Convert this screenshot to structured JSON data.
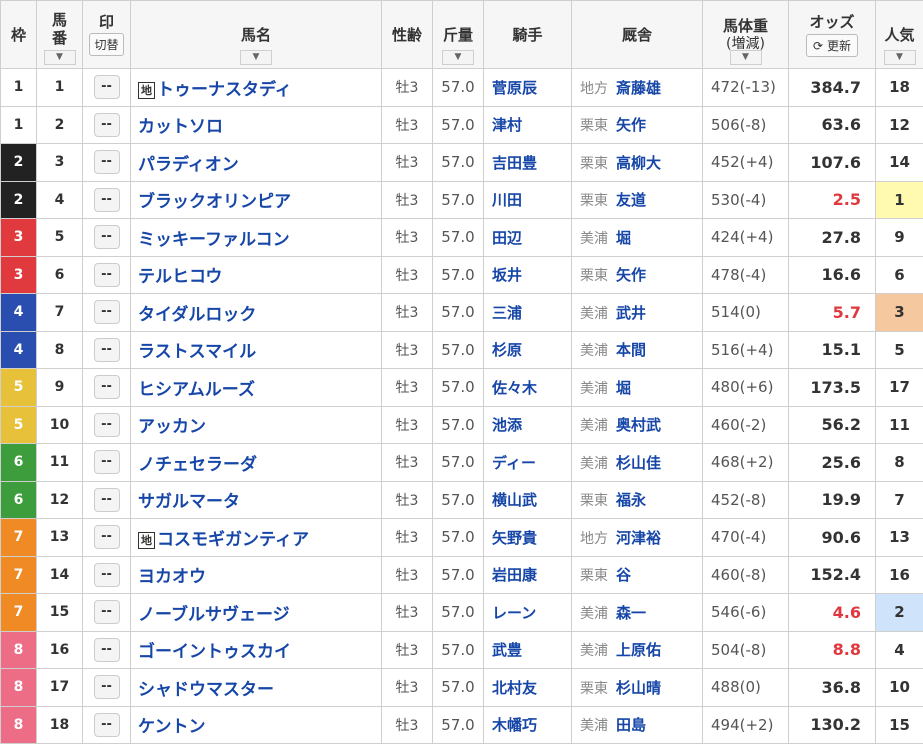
{
  "headers": {
    "waku": "枠",
    "umaban": "馬\n番",
    "mark": "印",
    "mark_toggle": "切替",
    "horse": "馬名",
    "sexage": "性齢",
    "kinryo": "斤量",
    "jockey": "騎手",
    "stable": "厩舎",
    "weight": "馬体重",
    "weight_sub": "(増減)",
    "odds": "オッズ",
    "refresh": "更新",
    "popularity": "人気"
  },
  "mark_placeholder": "--",
  "chiho_badge": "地",
  "waku_colors": {
    "1": "#ffffff",
    "2": "#222222",
    "3": "#e03a3e",
    "4": "#2a4eb0",
    "5": "#e8c13a",
    "6": "#3d9c3c",
    "7": "#ef8a24",
    "8": "#ee6d86"
  },
  "rows": [
    {
      "waku": "1",
      "num": "1",
      "horse": "トゥーナスタディ",
      "chiho": true,
      "sexage": "牡3",
      "kinryo": "57.0",
      "jockey": "菅原辰",
      "region": "地方",
      "trainer": "斎藤雄",
      "weight": "472(-13)",
      "odds": "384.7",
      "pop": "18"
    },
    {
      "waku": "1",
      "num": "2",
      "horse": "カットソロ",
      "chiho": false,
      "sexage": "牡3",
      "kinryo": "57.0",
      "jockey": "津村",
      "region": "栗東",
      "trainer": "矢作",
      "weight": "506(-8)",
      "odds": "63.6",
      "pop": "12"
    },
    {
      "waku": "2",
      "num": "3",
      "horse": "パラディオン",
      "chiho": false,
      "sexage": "牡3",
      "kinryo": "57.0",
      "jockey": "吉田豊",
      "region": "栗東",
      "trainer": "高柳大",
      "weight": "452(+4)",
      "odds": "107.6",
      "pop": "14"
    },
    {
      "waku": "2",
      "num": "4",
      "horse": "ブラックオリンピア",
      "chiho": false,
      "sexage": "牡3",
      "kinryo": "57.0",
      "jockey": "川田",
      "region": "栗東",
      "trainer": "友道",
      "weight": "530(-4)",
      "odds": "2.5",
      "pop": "1"
    },
    {
      "waku": "3",
      "num": "5",
      "horse": "ミッキーファルコン",
      "chiho": false,
      "sexage": "牡3",
      "kinryo": "57.0",
      "jockey": "田辺",
      "region": "美浦",
      "trainer": "堀",
      "weight": "424(+4)",
      "odds": "27.8",
      "pop": "9"
    },
    {
      "waku": "3",
      "num": "6",
      "horse": "テルヒコウ",
      "chiho": false,
      "sexage": "牡3",
      "kinryo": "57.0",
      "jockey": "坂井",
      "region": "栗東",
      "trainer": "矢作",
      "weight": "478(-4)",
      "odds": "16.6",
      "pop": "6"
    },
    {
      "waku": "4",
      "num": "7",
      "horse": "タイダルロック",
      "chiho": false,
      "sexage": "牡3",
      "kinryo": "57.0",
      "jockey": "三浦",
      "region": "美浦",
      "trainer": "武井",
      "weight": "514(0)",
      "odds": "5.7",
      "pop": "3"
    },
    {
      "waku": "4",
      "num": "8",
      "horse": "ラストスマイル",
      "chiho": false,
      "sexage": "牡3",
      "kinryo": "57.0",
      "jockey": "杉原",
      "region": "美浦",
      "trainer": "本間",
      "weight": "516(+4)",
      "odds": "15.1",
      "pop": "5"
    },
    {
      "waku": "5",
      "num": "9",
      "horse": "ヒシアムルーズ",
      "chiho": false,
      "sexage": "牡3",
      "kinryo": "57.0",
      "jockey": "佐々木",
      "region": "美浦",
      "trainer": "堀",
      "weight": "480(+6)",
      "odds": "173.5",
      "pop": "17"
    },
    {
      "waku": "5",
      "num": "10",
      "horse": "アッカン",
      "chiho": false,
      "sexage": "牡3",
      "kinryo": "57.0",
      "jockey": "池添",
      "region": "美浦",
      "trainer": "奥村武",
      "weight": "460(-2)",
      "odds": "56.2",
      "pop": "11"
    },
    {
      "waku": "6",
      "num": "11",
      "horse": "ノチェセラーダ",
      "chiho": false,
      "sexage": "牡3",
      "kinryo": "57.0",
      "jockey": "ディー",
      "region": "美浦",
      "trainer": "杉山佳",
      "weight": "468(+2)",
      "odds": "25.6",
      "pop": "8"
    },
    {
      "waku": "6",
      "num": "12",
      "horse": "サガルマータ",
      "chiho": false,
      "sexage": "牡3",
      "kinryo": "57.0",
      "jockey": "横山武",
      "region": "栗東",
      "trainer": "福永",
      "weight": "452(-8)",
      "odds": "19.9",
      "pop": "7"
    },
    {
      "waku": "7",
      "num": "13",
      "horse": "コスモギガンティア",
      "chiho": true,
      "sexage": "牡3",
      "kinryo": "57.0",
      "jockey": "矢野貴",
      "region": "地方",
      "trainer": "河津裕",
      "weight": "470(-4)",
      "odds": "90.6",
      "pop": "13"
    },
    {
      "waku": "7",
      "num": "14",
      "horse": "ヨカオウ",
      "chiho": false,
      "sexage": "牡3",
      "kinryo": "57.0",
      "jockey": "岩田康",
      "region": "栗東",
      "trainer": "谷",
      "weight": "460(-8)",
      "odds": "152.4",
      "pop": "16"
    },
    {
      "waku": "7",
      "num": "15",
      "horse": "ノーブルサヴェージ",
      "chiho": false,
      "sexage": "牡3",
      "kinryo": "57.0",
      "jockey": "レーン",
      "region": "美浦",
      "trainer": "森一",
      "weight": "546(-6)",
      "odds": "4.6",
      "pop": "2"
    },
    {
      "waku": "8",
      "num": "16",
      "horse": "ゴーイントゥスカイ",
      "chiho": false,
      "sexage": "牡3",
      "kinryo": "57.0",
      "jockey": "武豊",
      "region": "美浦",
      "trainer": "上原佑",
      "weight": "504(-8)",
      "odds": "8.8",
      "pop": "4"
    },
    {
      "waku": "8",
      "num": "17",
      "horse": "シャドウマスター",
      "chiho": false,
      "sexage": "牡3",
      "kinryo": "57.0",
      "jockey": "北村友",
      "region": "栗東",
      "trainer": "杉山晴",
      "weight": "488(0)",
      "odds": "36.8",
      "pop": "10"
    },
    {
      "waku": "8",
      "num": "18",
      "horse": "ケントン",
      "chiho": false,
      "sexage": "牡3",
      "kinryo": "57.0",
      "jockey": "木幡巧",
      "region": "美浦",
      "trainer": "田島",
      "weight": "494(+2)",
      "odds": "130.2",
      "pop": "15"
    }
  ]
}
